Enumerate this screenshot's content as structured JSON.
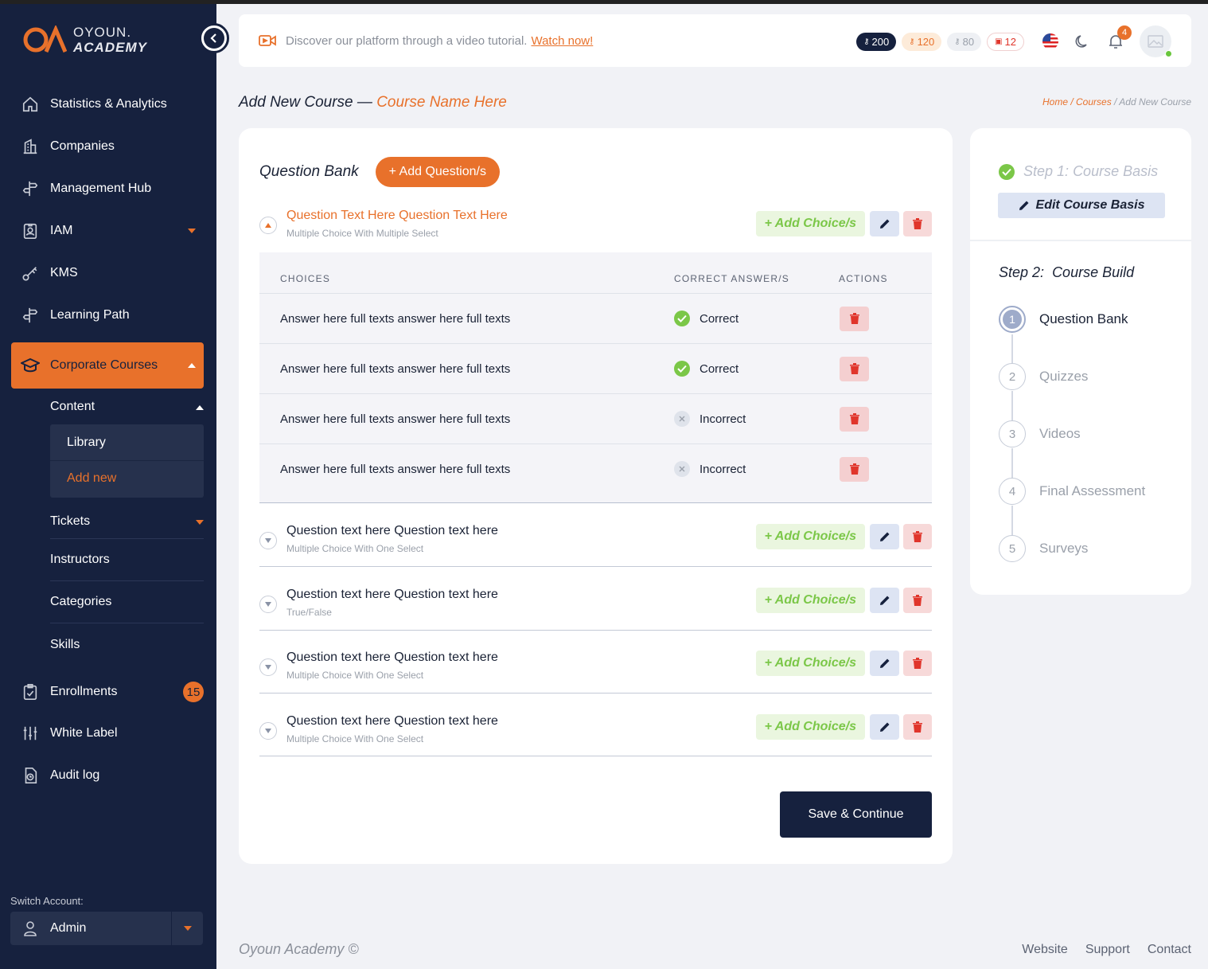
{
  "brand": {
    "line1": "OYOUN.",
    "line2": "ACADEMY"
  },
  "sidebar": {
    "items": [
      {
        "label": "Statistics & Analytics",
        "icon": "home-icon"
      },
      {
        "label": "Companies",
        "icon": "building-icon"
      },
      {
        "label": "Management Hub",
        "icon": "signpost-icon"
      },
      {
        "label": "IAM",
        "icon": "id-badge-icon"
      },
      {
        "label": "KMS",
        "icon": "key-icon"
      },
      {
        "label": "Learning Path",
        "icon": "signpost-icon"
      },
      {
        "label": "Corporate Courses",
        "icon": "graduation-cap-icon"
      },
      {
        "label": "Enrollments",
        "icon": "clipboard-icon",
        "badge": "15"
      },
      {
        "label": "White Label",
        "icon": "sliders-icon"
      },
      {
        "label": "Audit log",
        "icon": "document-clock-icon"
      }
    ],
    "content_label": "Content",
    "library_label": "Library",
    "add_new_label": "Add new",
    "subitems": [
      "Tickets",
      "Instructors",
      "Categories",
      "Skills"
    ],
    "switch_account_label": "Switch Account:",
    "account_value": "Admin"
  },
  "topbar": {
    "tutorial_text": "Discover our platform through a video tutorial.",
    "tutorial_link": "Watch now!",
    "pills": [
      "200",
      "120",
      "80",
      "12"
    ],
    "notification_count": "4"
  },
  "page": {
    "title_prefix": "Add New Course —",
    "title_name": "Course Name Here",
    "breadcrumb": [
      "Home",
      "Courses",
      "Add New Course"
    ]
  },
  "question_bank": {
    "title": "Question Bank",
    "add_button": "+ Add Question/s",
    "add_choice_label": "+ Add Choice/s",
    "columns": [
      "CHOICES",
      "CORRECT ANSWER/S",
      "ACTIONS"
    ],
    "questions": [
      {
        "text": "Question Text Here Question Text Here",
        "type": "Multiple Choice With Multiple Select",
        "expanded": true
      },
      {
        "text": "Question text here Question text here",
        "type": "Multiple Choice With One Select"
      },
      {
        "text": "Question text here Question text here",
        "type": "True/False"
      },
      {
        "text": "Question text here Question text here",
        "type": "Multiple Choice With One Select"
      },
      {
        "text": "Question text here Question text here",
        "type": "Multiple Choice With One Select"
      }
    ],
    "choices": [
      {
        "answer": "Answer here full texts answer here full texts",
        "status": "Correct"
      },
      {
        "answer": "Answer here full texts answer here full texts",
        "status": "Correct"
      },
      {
        "answer": "Answer here full texts answer here full texts",
        "status": "Incorrect"
      },
      {
        "answer": "Answer here full texts answer here full texts",
        "status": "Incorrect"
      }
    ],
    "save_button": "Save & Continue"
  },
  "steps": {
    "step1_prefix": "Step 1:",
    "step1_name": "Course Basis",
    "edit_basis": "Edit Course Basis",
    "step2_prefix": "Step 2:",
    "step2_name": "Course Build",
    "items": [
      {
        "num": "1",
        "label": "Question Bank"
      },
      {
        "num": "2",
        "label": "Quizzes"
      },
      {
        "num": "3",
        "label": "Videos"
      },
      {
        "num": "4",
        "label": "Final Assessment"
      },
      {
        "num": "5",
        "label": "Surveys"
      }
    ]
  },
  "footer": {
    "copyright": "Oyoun Academy ©",
    "links": [
      "Website",
      "Support",
      "Contact"
    ]
  },
  "colors": {
    "accent": "#e8712b",
    "navy": "#16213e",
    "success": "#7bc748",
    "danger": "#e0352b"
  }
}
